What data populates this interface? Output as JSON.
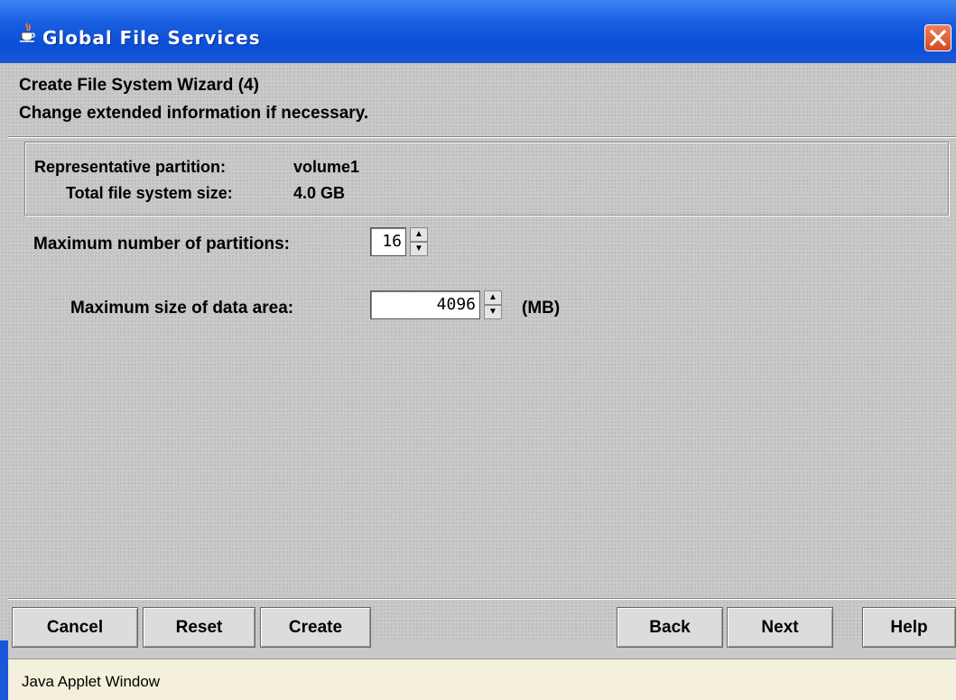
{
  "window": {
    "title": "Global File Services",
    "app_icon": "java-cup-icon",
    "close_icon": "close-icon"
  },
  "wizard": {
    "heading": "Create File System Wizard (4)",
    "instruction": "Change extended information if necessary."
  },
  "info": {
    "partition_label": "Representative partition:",
    "partition_value": "volume1",
    "size_label": "Total file system size:",
    "size_value": "4.0 GB"
  },
  "fields": {
    "max_partitions_label": "Maximum number of partitions:",
    "max_partitions_value": "16",
    "max_data_area_label": "Maximum size of data area:",
    "max_data_area_value": "4096",
    "max_data_area_unit": "(MB)"
  },
  "buttons": {
    "cancel": "Cancel",
    "reset": "Reset",
    "create": "Create",
    "back": "Back",
    "next": "Next",
    "help": "Help"
  },
  "status": {
    "text": "Java Applet Window"
  },
  "colors": {
    "titlebar": "#0a4fd6",
    "panel": "#c9c9c9",
    "close": "#d34a20",
    "status_bg": "#f5f0dc"
  }
}
